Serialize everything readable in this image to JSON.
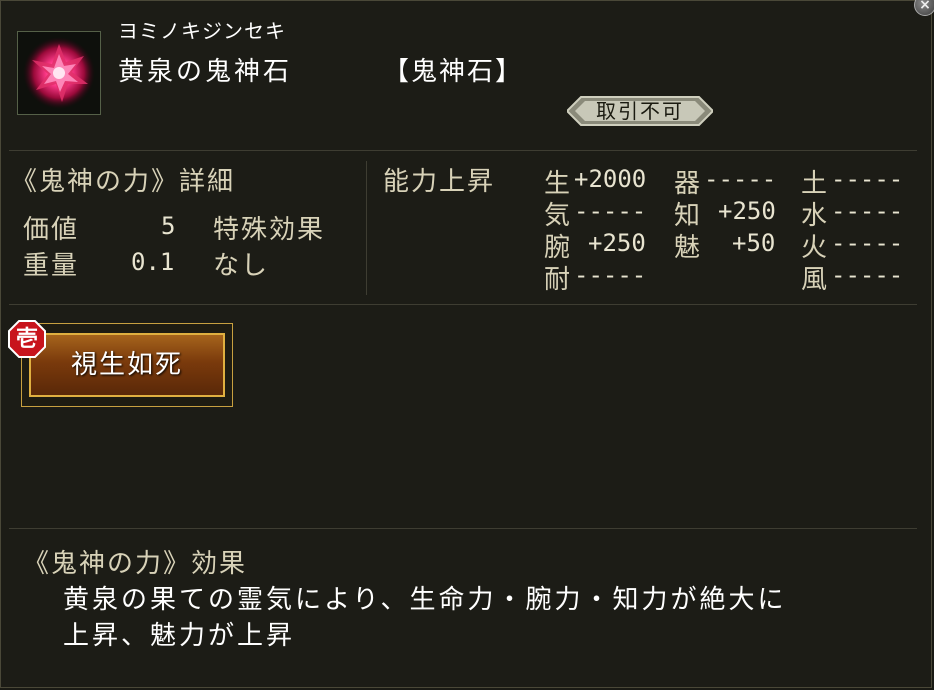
{
  "item": {
    "kana": "ヨミノキジンセキ",
    "name": "黄泉の鬼神石",
    "category": "【鬼神石】",
    "trade_badge": "取引不可",
    "icon": "red-crystal-gem-icon"
  },
  "details": {
    "title": "《鬼神の力》詳細",
    "value_label": "価値",
    "value": "5",
    "weight_label": "重量",
    "weight": "0.1",
    "special_label": "特殊効果",
    "special_value": "なし"
  },
  "ability": {
    "title": "能力上昇",
    "stats": [
      {
        "key": "生",
        "value": "+2000"
      },
      {
        "key": "器",
        "value": "-----"
      },
      {
        "key": "土",
        "value": "-----"
      },
      {
        "key": "気",
        "value": "-----"
      },
      {
        "key": "知",
        "value": "+250"
      },
      {
        "key": "水",
        "value": "-----"
      },
      {
        "key": "腕",
        "value": "+250"
      },
      {
        "key": "魅",
        "value": "+50"
      },
      {
        "key": "火",
        "value": "-----"
      },
      {
        "key": "耐",
        "value": "-----"
      },
      {
        "key": "風",
        "value": "-----"
      }
    ]
  },
  "skill": {
    "badge": "壱",
    "label": "視生如死"
  },
  "effect": {
    "title": "《鬼神の力》効果",
    "line1": "黄泉の果ての霊気により、生命力・腕力・知力が絶大に",
    "line2": "上昇、魅力が上昇"
  },
  "colors": {
    "panel": "#1c1c16",
    "text": "#d8d2b8",
    "skill_bar": "#7a3a0c",
    "badge_red": "#c8141c"
  }
}
